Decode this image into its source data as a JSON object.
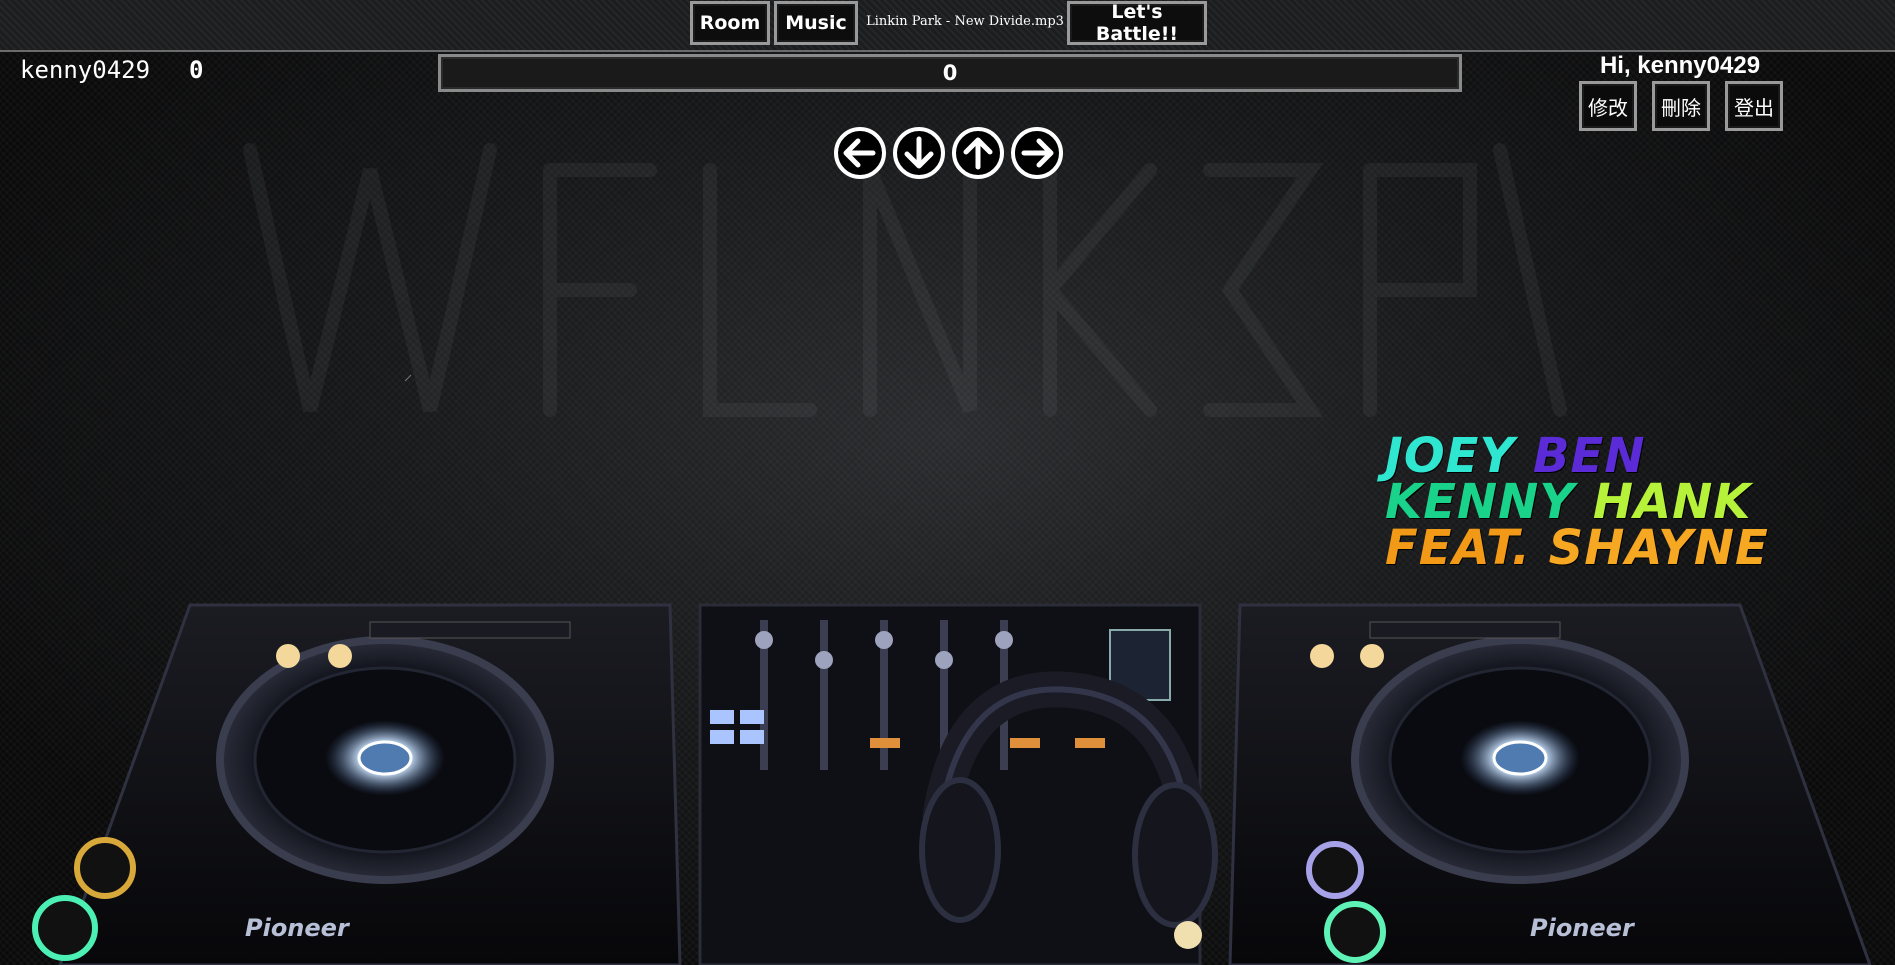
{
  "topbar": {
    "room_label": "Room",
    "music_label": "Music",
    "song_name": "Linkin Park - New Divide.mp3",
    "battle_label": "Let's Battle!!"
  },
  "player": {
    "username": "kenny0429",
    "score": "0"
  },
  "scorebar": {
    "value": "0"
  },
  "account": {
    "greeting": "Hi, kenny0429",
    "edit_label": "修改",
    "delete_label": "刪除",
    "logout_label": "登出"
  },
  "arrows": [
    "arrow-left-icon",
    "arrow-down-icon",
    "arrow-up-icon",
    "arrow-right-icon"
  ],
  "logo": {
    "line1_a": "JOEY",
    "line1_b": "BEN",
    "line2_a": "KENNY",
    "line2_b": "HANK",
    "line3_a": "FEAT.",
    "line3_b": "SHAYNE",
    "colors": {
      "joey": "#2fe7d0",
      "ben": "#5a2bd6",
      "kenny": "#19d38a",
      "hank": "#b6f23a",
      "feat": "#f29a18",
      "shayne": "#f7a823"
    },
    "brand_left": "Pioneer",
    "brand_right": "Pioneer"
  }
}
